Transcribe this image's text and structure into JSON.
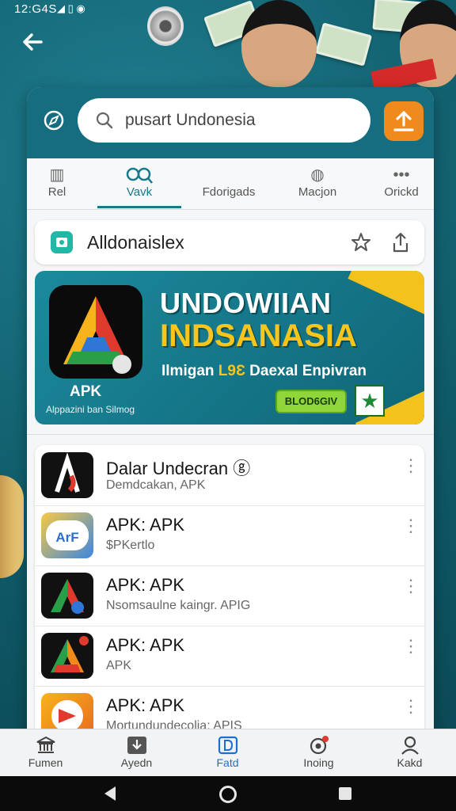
{
  "status_bar": {
    "time": "12:G4S",
    "icons": "◢ ▯  ◉"
  },
  "search": {
    "value": "pusart Undonesia"
  },
  "tabs": [
    {
      "label": "Rel",
      "icon": "building-icon"
    },
    {
      "label": "Vavk",
      "icon": "search-binoculars-icon",
      "active": true
    },
    {
      "label": "Fdorigads",
      "icon": "none"
    },
    {
      "label": "Macjon",
      "icon": "globe-icon"
    },
    {
      "label": "Orickd",
      "icon": "more-dots-icon"
    }
  ],
  "app": {
    "title": "Alldonaislex"
  },
  "banner": {
    "headline1": "UNDOWIIAN",
    "headline2": "INDSANASIA",
    "tagline_prefix": "Ilmigan",
    "tagline_highlight": "L9Ɛ",
    "tagline_suffix": "Daexal Enpivran",
    "apk_label": "APK",
    "sub_label": "Alppazini ban Silmog",
    "cta_label": "BLOD6GIV"
  },
  "list": [
    {
      "name": "Dalar Undecran ⓖ",
      "sub": "Demdcakan,  APK"
    },
    {
      "name": "APK: APK",
      "sub": "$PKertlo"
    },
    {
      "name": "APK: APK",
      "sub": "Nsomsaulne kaingr. APIG"
    },
    {
      "name": "APK: APK",
      "sub": "APK"
    },
    {
      "name": "APK: APK",
      "sub": "Mortundundecolia: APIS"
    }
  ],
  "bottom_nav": [
    {
      "label": "Fumen",
      "icon": "bank-icon"
    },
    {
      "label": "Ayedn",
      "icon": "download-icon"
    },
    {
      "label": "Fatd",
      "icon": "d-box-icon",
      "active": true
    },
    {
      "label": "Inoing",
      "icon": "target-icon"
    },
    {
      "label": "Kakd",
      "icon": "user-icon"
    }
  ],
  "colors": {
    "header_teal": "#156d7f",
    "accent_orange": "#f08a1c",
    "active_blue": "#1a6fd1",
    "banner_yellow": "#f7c51b"
  }
}
